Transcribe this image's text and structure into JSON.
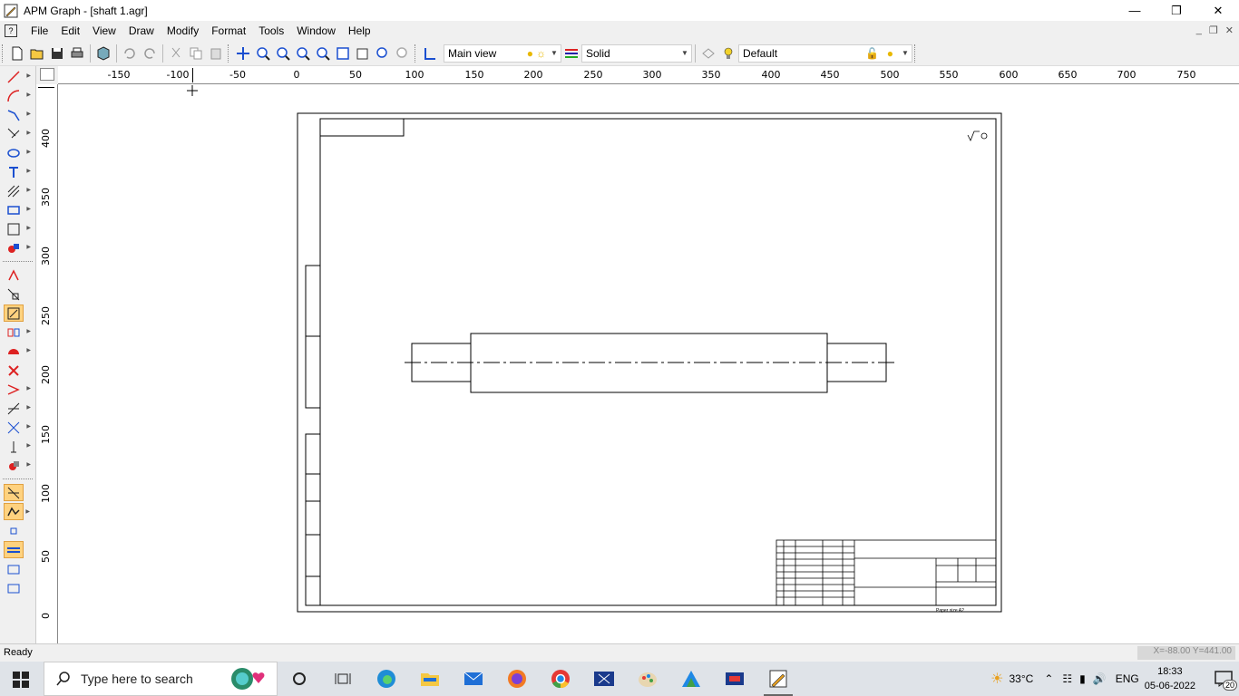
{
  "window": {
    "title": "APM Graph - [shaft 1.agr]"
  },
  "menu": [
    "File",
    "Edit",
    "View",
    "Draw",
    "Modify",
    "Format",
    "Tools",
    "Window",
    "Help"
  ],
  "toolbar": {
    "view_combo": "Main view",
    "linetype_combo": "Solid",
    "layer_combo": "Default"
  },
  "ruler": {
    "h_ticks": [
      "-150",
      "-100",
      "-50",
      "0",
      "50",
      "100",
      "150",
      "200",
      "250",
      "300",
      "350",
      "400",
      "450",
      "500",
      "550",
      "600",
      "650",
      "700",
      "750"
    ],
    "v_ticks": [
      "400",
      "350",
      "300",
      "250",
      "200",
      "150",
      "100",
      "50",
      "0"
    ]
  },
  "status": {
    "ready": "Ready",
    "coords": "X=-88.00 Y=441.00"
  },
  "drawing": {
    "paper_size": "Paper size A2"
  },
  "taskbar": {
    "search_placeholder": "Type here to search",
    "temperature": "33°C",
    "language": "ENG",
    "time": "18:33",
    "date": "05-06-2022",
    "notifications": "20"
  }
}
